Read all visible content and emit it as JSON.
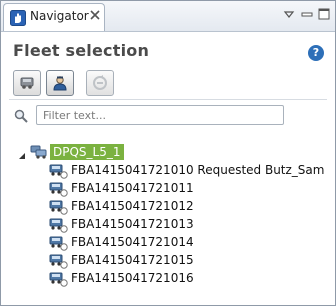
{
  "view": {
    "tab_label": "Navigator",
    "heading": "Fleet selection"
  },
  "filter": {
    "placeholder": "Filter text..."
  },
  "tree": {
    "root": {
      "label": "DPQS_L5_1",
      "expanded": true,
      "selected": true,
      "highlight_color": "#7bb240"
    },
    "children": [
      {
        "label": "FBA1415041721010 Requested Butz_Sam"
      },
      {
        "label": "FBA1415041721011"
      },
      {
        "label": "FBA1415041721012"
      },
      {
        "label": "FBA1415041721013"
      },
      {
        "label": "FBA1415041721014"
      },
      {
        "label": "FBA1415041721015"
      },
      {
        "label": "FBA1415041721016"
      }
    ]
  },
  "icons": {
    "tab": "navigator-hand-icon",
    "close": "close-icon",
    "help": "help-icon",
    "toolbar": [
      "vehicle-icon",
      "driver-icon",
      "refresh-icon"
    ],
    "filter": "search-icon",
    "root": "fleet-group-icon",
    "child": "vehicle-status-icon"
  },
  "colors": {
    "help_blue": "#2d6fb8",
    "selection_green": "#7bb240"
  }
}
